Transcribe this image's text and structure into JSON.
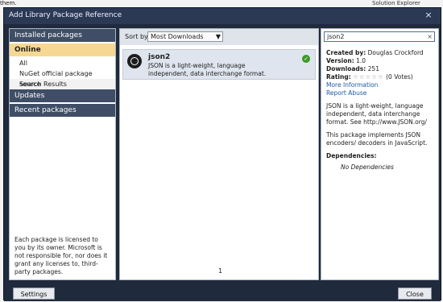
{
  "top": {
    "cut_text": "them.",
    "right_title": "Solution Explorer"
  },
  "dialog": {
    "title": "Add Library Package Reference",
    "close_glyph": "×"
  },
  "left_panel": {
    "categories": [
      {
        "label": "Installed packages"
      },
      {
        "label": "Online"
      },
      {
        "label": "Updates"
      },
      {
        "label": "Recent packages"
      }
    ],
    "online_items": [
      {
        "label": "All"
      },
      {
        "label": "NuGet official package source"
      },
      {
        "label": "Search Results"
      }
    ],
    "license_note": "Each package is licensed to you by its owner. Microsoft is not responsible for, nor does it grant any licenses to, third-party packages."
  },
  "main_panel": {
    "sort_label": "Sort by",
    "sort_value": "Most Downloads",
    "sort_arrow": "▼",
    "package": {
      "name": "json2",
      "description": "JSON is a light-weight, language independent, data interchange format.",
      "installed_mark": "✓"
    },
    "page_number": "1"
  },
  "right_panel": {
    "search_value": "json2",
    "search_clear": "×",
    "created_by_label": "Created by:",
    "created_by_value": "Douglas Crockford",
    "version_label": "Version:",
    "version_value": "1.0",
    "downloads_label": "Downloads:",
    "downloads_value": "251",
    "rating_label": "Rating:",
    "rating_stars": "☆☆☆☆☆",
    "rating_votes": "(0 Votes)",
    "more_info": "More Information",
    "report_abuse": "Report Abuse",
    "desc_1": "JSON is a light-weight, language independent, data interchange format. See http://www.JSON.org/",
    "desc_2": "This package implements JSON encoders/ decoders in JavaScript.",
    "dependencies_label": "Dependencies:",
    "dependencies_value": "No Dependencies"
  },
  "buttons": {
    "settings": "Settings",
    "close": "Close"
  }
}
